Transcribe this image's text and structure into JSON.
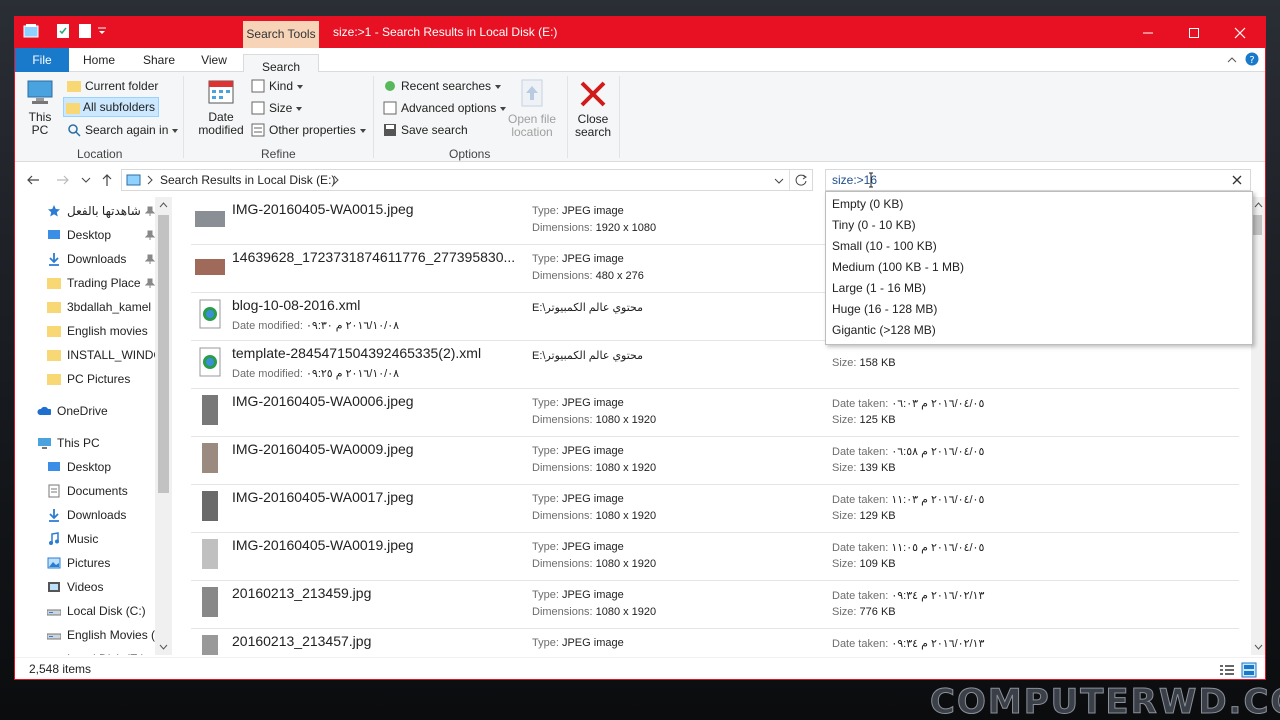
{
  "window": {
    "title": "size:>1 - Search Results in Local Disk (E:)",
    "context_tab": "Search Tools",
    "accent_color": "#e81123"
  },
  "menu": {
    "tabs": [
      "File",
      "Home",
      "Share",
      "View",
      "Search"
    ],
    "active_tab": "Search"
  },
  "ribbon": {
    "location": {
      "label": "Location",
      "this_pc": "This PC",
      "current_folder": "Current folder",
      "all_subfolders": "All subfolders",
      "search_again_in": "Search again in"
    },
    "refine": {
      "label": "Refine",
      "date_modified": "Date modified",
      "kind": "Kind",
      "size": "Size",
      "other_properties": "Other properties"
    },
    "options": {
      "label": "Options",
      "recent_searches": "Recent searches",
      "advanced_options": "Advanced options",
      "save_search": "Save search",
      "open_file_location": "Open file location"
    },
    "close_search": "Close search"
  },
  "address": {
    "path": "Search Results in Local Disk (E:)"
  },
  "search": {
    "value": "size:>16"
  },
  "size_dropdown": {
    "options": [
      "Empty (0 KB)",
      "Tiny (0 - 10 KB)",
      "Small (10 - 100 KB)",
      "Medium (100 KB - 1 MB)",
      "Large (1 - 16 MB)",
      "Huge (16 - 128 MB)",
      "Gigantic (>128 MB)"
    ]
  },
  "sidebar": {
    "quick_access": [
      {
        "label": "شاهدتها بالفعل",
        "icon": "star-icon"
      },
      {
        "label": "Desktop",
        "icon": "desktop-icon"
      },
      {
        "label": "Downloads",
        "icon": "download-icon"
      },
      {
        "label": "Trading Place",
        "icon": "folder-icon"
      },
      {
        "label": "3bdallah_kamel",
        "icon": "folder-icon"
      },
      {
        "label": "English movies",
        "icon": "folder-icon"
      },
      {
        "label": "INSTALL_WINDO",
        "icon": "folder-icon"
      },
      {
        "label": "PC Pictures",
        "icon": "folder-icon"
      }
    ],
    "onedrive": "OneDrive",
    "this_pc": "This PC",
    "pc_items": [
      {
        "label": "Desktop",
        "icon": "desktop-icon"
      },
      {
        "label": "Documents",
        "icon": "documents-icon"
      },
      {
        "label": "Downloads",
        "icon": "download-icon"
      },
      {
        "label": "Music",
        "icon": "music-icon"
      },
      {
        "label": "Pictures",
        "icon": "pictures-icon"
      },
      {
        "label": "Videos",
        "icon": "videos-icon"
      },
      {
        "label": "Local Disk (C:)",
        "icon": "drive-icon"
      },
      {
        "label": "English Movies (",
        "icon": "drive-icon"
      },
      {
        "label": "Local Disk (E:)",
        "icon": "drive-icon"
      }
    ]
  },
  "labels": {
    "type": "Type:",
    "dimensions": "Dimensions:",
    "date_modified": "Date modified:",
    "date_taken": "Date taken:",
    "size": "Size:"
  },
  "files": [
    {
      "name": "IMG-20160405-WA0015.jpeg",
      "kind": "image",
      "type": "JPEG image",
      "dimensions": "1920 x 1080",
      "date_taken": "",
      "size": ""
    },
    {
      "name": "14639628_1723731874611776_277395830...",
      "kind": "image",
      "type": "JPEG image",
      "dimensions": "480 x 276",
      "date_taken": "",
      "size": ""
    },
    {
      "name": "blog-10-08-2016.xml",
      "kind": "xml",
      "date_modified": "٢٠١٦/١٠/٠٨ م ٠٩:٣٠",
      "location": "E:\\محتوي عالم الكمبيوتر",
      "size": ""
    },
    {
      "name": "template-2845471504392465335(2).xml",
      "kind": "xml",
      "date_modified": "٢٠١٦/١٠/٠٨ م ٠٩:٢٥",
      "location": "E:\\محتوي عالم الكمبيوتر",
      "size": "158 KB"
    },
    {
      "name": "IMG-20160405-WA0006.jpeg",
      "kind": "image",
      "type": "JPEG image",
      "dimensions": "1080 x 1920",
      "date_taken": "٢٠١٦/٠٤/٠٥ م ٠٦:٠٣",
      "size": "125 KB"
    },
    {
      "name": "IMG-20160405-WA0009.jpeg",
      "kind": "image",
      "type": "JPEG image",
      "dimensions": "1080 x 1920",
      "date_taken": "٢٠١٦/٠٤/٠٥ م ٠٦:٥٨",
      "size": "139 KB"
    },
    {
      "name": "IMG-20160405-WA0017.jpeg",
      "kind": "image",
      "type": "JPEG image",
      "dimensions": "1080 x 1920",
      "date_taken": "٢٠١٦/٠٤/٠٥ م ١١:٠٣",
      "size": "129 KB"
    },
    {
      "name": "IMG-20160405-WA0019.jpeg",
      "kind": "image",
      "type": "JPEG image",
      "dimensions": "1080 x 1920",
      "date_taken": "٢٠١٦/٠٤/٠٥ م ١١:٠٥",
      "size": "109 KB"
    },
    {
      "name": "20160213_213459.jpg",
      "kind": "image",
      "type": "JPEG image",
      "dimensions": "1080 x 1920",
      "date_taken": "٢٠١٦/٠٢/١٣ م ٠٩:٣٤",
      "size": "776 KB"
    },
    {
      "name": "20160213_213457.jpg",
      "kind": "image",
      "type": "JPEG image",
      "dimensions": "",
      "date_taken": "٢٠١٦/٠٢/١٣ م ٠٩:٣٤",
      "size": ""
    }
  ],
  "status": {
    "items": "2,548 items"
  },
  "watermark": "COMPUTERWD.COM"
}
